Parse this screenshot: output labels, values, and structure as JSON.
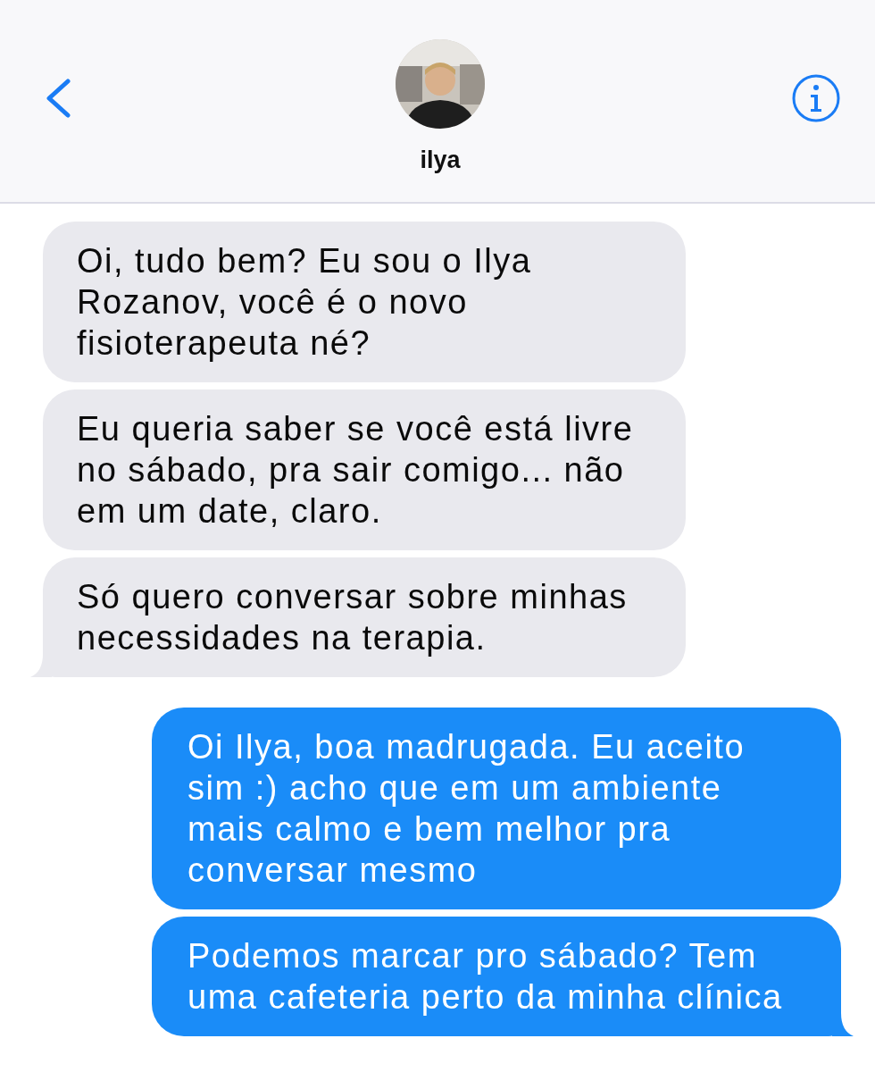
{
  "header": {
    "contact_name": "ilya"
  },
  "messages": [
    {
      "kind": "received",
      "text": "Oi, tudo bem? Eu sou o Ilya Rozanov, você é o novo fisioterapeuta né?",
      "tail": false
    },
    {
      "kind": "received",
      "text": "Eu queria saber se você está livre no sábado, pra sair comigo... não em um date, claro.",
      "tail": false
    },
    {
      "kind": "received",
      "text": "Só quero conversar sobre minhas necessidades na terapia.",
      "tail": true
    },
    {
      "kind": "sent",
      "text": "Oi Ilya, boa madrugada. Eu aceito sim :) acho que em um ambiente mais calmo e bem melhor pra conversar mesmo",
      "tail": false
    },
    {
      "kind": "sent",
      "text": "Podemos marcar pro sábado? Tem uma cafeteria perto da minha clínica",
      "tail": true
    }
  ]
}
